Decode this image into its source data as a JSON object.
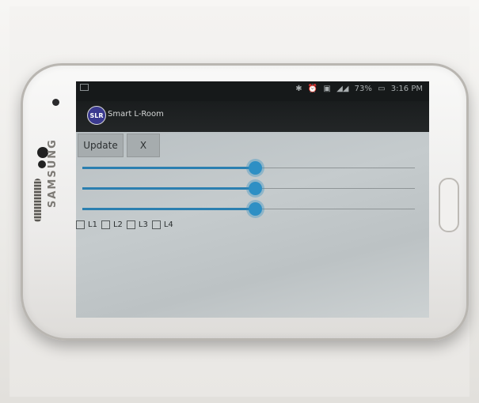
{
  "status_bar": {
    "notification_icon": "image-notification-icon",
    "icons": [
      "bluetooth-icon",
      "alarm-icon",
      "nfc-icon",
      "signal-icon"
    ],
    "battery": "73%",
    "time": "3:16 PM"
  },
  "app": {
    "logo_text": "SLR",
    "title": "Smart L-Room"
  },
  "toolbar": {
    "update_label": "Update",
    "close_label": "X"
  },
  "sliders": [
    {
      "name": "slider-1",
      "value": 0.52
    },
    {
      "name": "slider-2",
      "value": 0.52
    },
    {
      "name": "slider-3",
      "value": 0.52
    }
  ],
  "checkboxes": [
    {
      "label": "L1",
      "checked": false
    },
    {
      "label": "L2",
      "checked": false
    },
    {
      "label": "L3",
      "checked": false
    },
    {
      "label": "L4",
      "checked": false
    }
  ],
  "device": {
    "brand": "SAMSUNG"
  },
  "colors": {
    "accent": "#2e8fc4",
    "screen_bg": "#c2c8ca",
    "action_bar": "#1a1d1e"
  }
}
